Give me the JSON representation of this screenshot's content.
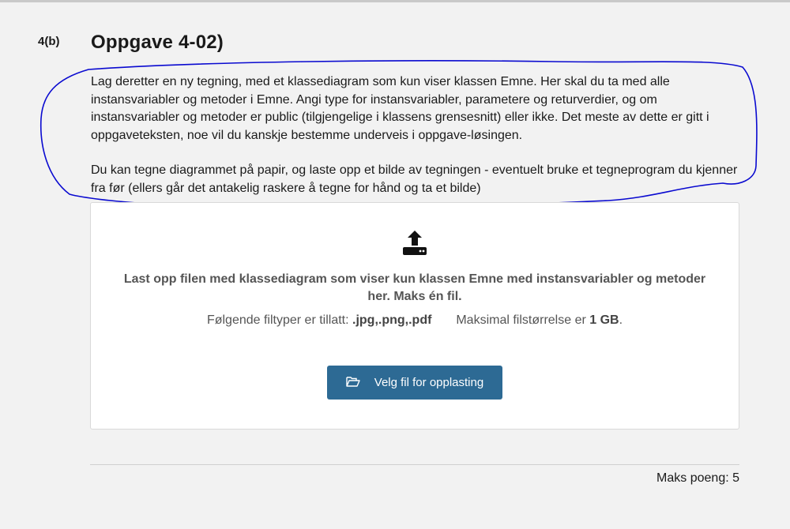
{
  "question": {
    "number": "4(b)",
    "title": "Oppgave 4-02)",
    "paragraphs": [
      "Lag deretter en ny tegning, med et klassediagram som kun viser klassen Emne. Her skal du ta med alle instansvariabler og metoder i Emne. Angi type for instansvariabler, parametere og returverdier, og om instansvariabler og metoder er public (tilgjengelige i klassens grensesnitt) eller ikke. Det meste av dette er gitt i oppgaveteksten, noe vil du kanskje bestemme underveis i oppgave-løsingen.",
      "Du kan tegne diagrammet på papir, og laste opp et bilde av tegningen - eventuelt bruke et tegneprogram du kjenner fra før (ellers går det antakelig raskere å tegne for hånd og ta et bilde)"
    ]
  },
  "upload": {
    "icon": "upload-icon",
    "title": "Last opp filen med klassediagram som viser kun klassen Emne med instansvariabler og metoder her. Maks én fil.",
    "filetypes_label": "Følgende filtyper er tillatt:",
    "filetypes": ".jpg,.png,.pdf",
    "maxsize_label": "Maksimal filstørrelse er",
    "maxsize": "1 GB",
    "maxsize_suffix": ".",
    "button_label": "Velg fil for opplasting",
    "button_icon": "folder-open-icon",
    "button_color": "#2d6a94"
  },
  "footer": {
    "max_points": "Maks poeng: 5"
  },
  "annotation_color": "#0a0ad0"
}
